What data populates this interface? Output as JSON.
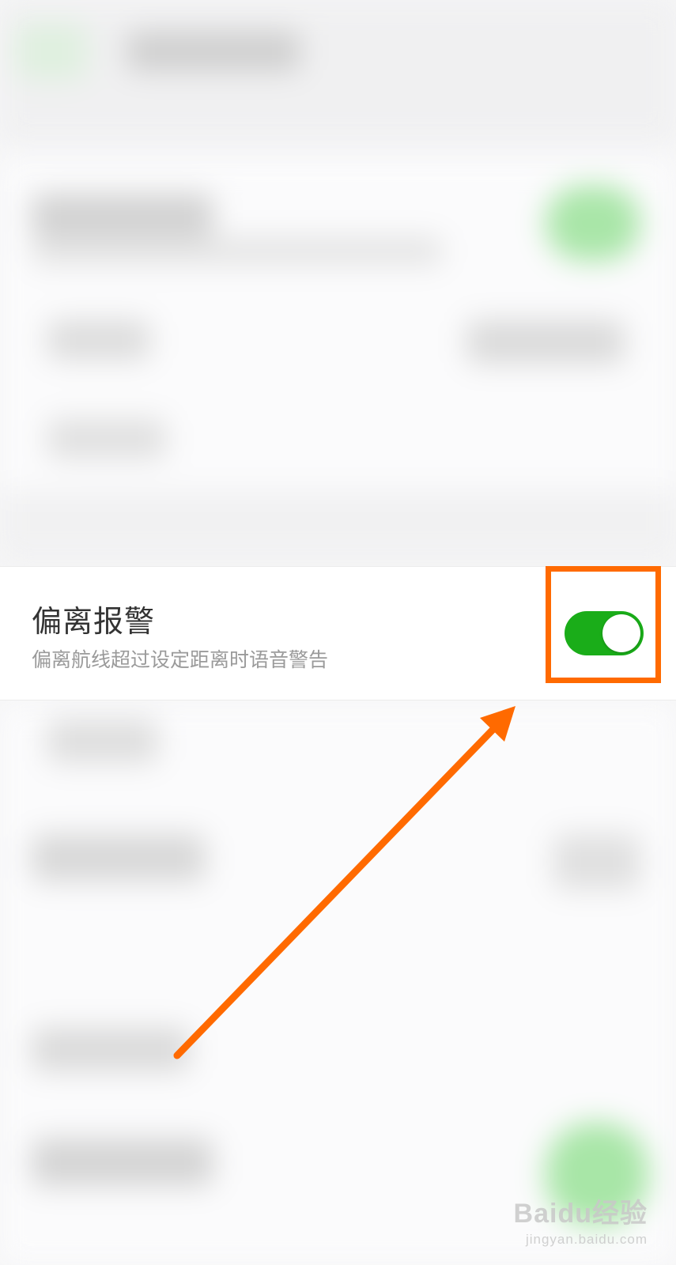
{
  "setting": {
    "title": "偏离报警",
    "description": "偏离航线超过设定距离时语音警告",
    "toggle_on": true
  },
  "colors": {
    "toggle_on": "#1aad19",
    "annotation": "#ff6a00"
  },
  "watermark": {
    "logo": "Baidu经验",
    "url": "jingyan.baidu.com"
  }
}
